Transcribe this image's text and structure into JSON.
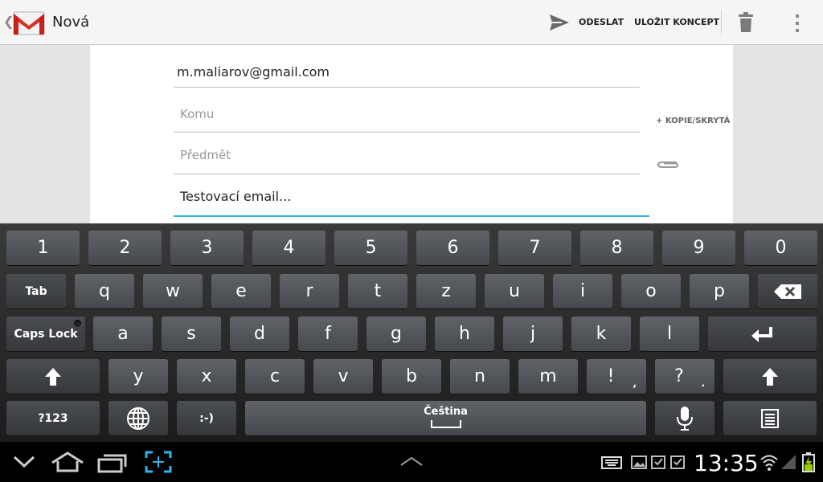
{
  "app": {
    "title": "Nová"
  },
  "actions": {
    "send": "ODESLAT",
    "save_draft": "ULOŽIT KONCEPT"
  },
  "compose": {
    "from": "m.maliarov@gmail.com",
    "to_placeholder": "Komu",
    "subject_placeholder": "Předmět",
    "body": "Testovací email...",
    "cc_bcc": "+ KOPIE/SKRYTÁ"
  },
  "keyboard": {
    "row1": [
      "1",
      "2",
      "3",
      "4",
      "5",
      "6",
      "7",
      "8",
      "9",
      "0"
    ],
    "tab": "Tab",
    "row2": [
      "q",
      "w",
      "e",
      "r",
      "t",
      "z",
      "u",
      "i",
      "o",
      "p"
    ],
    "caps": "Caps Lock",
    "row3": [
      "a",
      "s",
      "d",
      "f",
      "g",
      "h",
      "j",
      "k",
      "l"
    ],
    "row4": [
      "y",
      "x",
      "c",
      "v",
      "b",
      "n",
      "m"
    ],
    "punct1": "!",
    "punct1_hint": ",",
    "punct2": "?",
    "punct2_hint": ".",
    "symbols": "?123",
    "smiley": ":-)",
    "language": "Čeština"
  },
  "status": {
    "time": "13:35"
  },
  "colors": {
    "accent": "#33b5e5",
    "gmail_red": "#d93025"
  }
}
